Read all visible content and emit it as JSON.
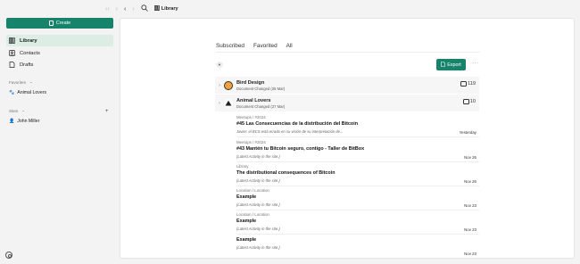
{
  "sidebar": {
    "create_label": "Create",
    "nav": [
      {
        "label": "Library"
      },
      {
        "label": "Contacts"
      },
      {
        "label": "Drafts"
      }
    ],
    "favorites_label": "Favorites",
    "favorites": [
      {
        "label": "Animal Lovers"
      }
    ],
    "sites_label": "Sites",
    "sites": [
      {
        "label": "John Miller"
      }
    ]
  },
  "topbar": {
    "breadcrumb": "Library"
  },
  "tabs": [
    {
      "label": "Subscribed",
      "active": true
    },
    {
      "label": "Favorited"
    },
    {
      "label": "All"
    }
  ],
  "toolbar": {
    "export_label": "Export",
    "more_label": "···"
  },
  "groups": [
    {
      "title": "Bird Design",
      "subtitle": "Document Changed",
      "date": "(26 Mar)",
      "count": "119"
    },
    {
      "title": "Animal Lovers",
      "subtitle": "Document Changed",
      "date": "(27 Mar)",
      "count": "10"
    }
  ],
  "items": [
    {
      "crumb": "Meetups / #2024",
      "title": "#45 Las Consecuencias de la distribución del Bitcoin",
      "desc": "Javier: el BCS está errado en su visión de su interpretación de...",
      "date": "Yesterday"
    },
    {
      "crumb": "Meetups / #2024",
      "title": "#43 Mantén tu Bitcoin seguro, contigo - Taller de BitBox",
      "desc": "(Latest Activity in the site.)",
      "date": "Nov 26"
    },
    {
      "crumb": "Library",
      "title": "The distributional consequences of Bitcoin",
      "desc": "(Latest Activity in the site.)",
      "date": "Nov 26"
    },
    {
      "crumb": "Location / Location",
      "title": "Example",
      "desc": "(Latest Activity in the site.)",
      "date": "Nov 23"
    },
    {
      "crumb": "Location / Location",
      "title": "Example",
      "desc": "(Latest Activity in the site.)",
      "date": "Nov 23"
    },
    {
      "crumb": "",
      "title": "Example",
      "desc": "(Latest Activity in the site.)",
      "date": "Nov 23"
    }
  ]
}
